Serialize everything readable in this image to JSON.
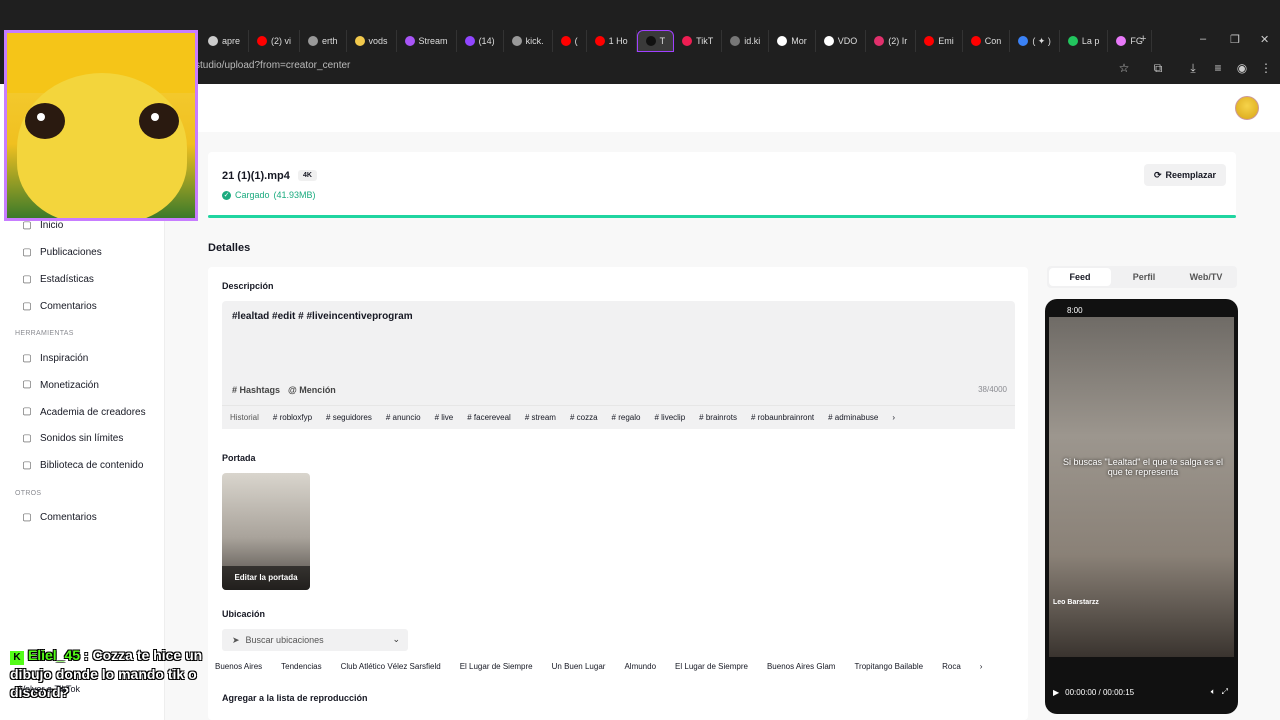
{
  "browser": {
    "tabs": [
      "apre",
      "(2) vi",
      "erth",
      "vods",
      "Stream",
      "(14)",
      "kick.",
      "(",
      "1 Ho",
      "T",
      "TikT",
      "id.ki",
      "Mor",
      "VDO",
      "(2) Ir",
      "Emi",
      "Con",
      "( ✦ )",
      "La p",
      "FG"
    ],
    "address": "studio/upload?from=creator_center"
  },
  "sidebar": {
    "items_top": [
      {
        "label": "Inicio",
        "icon": "home-icon"
      },
      {
        "label": "Publicaciones",
        "icon": "posts-icon"
      },
      {
        "label": "Estadísticas",
        "icon": "stats-icon"
      },
      {
        "label": "Comentarios",
        "icon": "comment-icon"
      }
    ],
    "section_tools": "HERRAMIENTAS",
    "items_tools": [
      {
        "label": "Inspiración",
        "icon": "bulb-icon"
      },
      {
        "label": "Monetización",
        "icon": "dollar-icon"
      },
      {
        "label": "Academia de creadores",
        "icon": "academy-icon"
      },
      {
        "label": "Sonidos sin límites",
        "icon": "music-icon"
      },
      {
        "label": "Biblioteca de contenido",
        "icon": "library-icon"
      }
    ],
    "section_others": "OTROS",
    "items_others": [
      {
        "label": "Comentarios",
        "icon": "feedback-icon"
      }
    ],
    "back": "Volver a TikTok"
  },
  "file": {
    "name": "21 (1)(1).mp4",
    "quality": "4K",
    "status": "Cargado",
    "size": "(41.93MB)",
    "replace": "Reemplazar",
    "progress": 1.0
  },
  "details": {
    "heading": "Detalles",
    "description_label": "Descripción",
    "description_text": "#lealtad  #edit  # #liveincentiveprogram",
    "hashtags": "# Hashtags",
    "mention": "@ Mención",
    "counter": "38/4000",
    "suggest_chips": [
      "Historial",
      "# robloxfyp",
      "# seguidores",
      "# anuncio",
      "# live",
      "# facereveal",
      "# stream",
      "# cozza",
      "# regalo",
      "# liveclip",
      "# brainrots",
      "# robaunbrainront",
      "# adminabuse"
    ],
    "cover_label": "Portada",
    "cover_edit": "Editar la portada",
    "location_label": "Ubicación",
    "location_placeholder": "Buscar ubicaciones",
    "location_chips": [
      "Buenos Aires",
      "Tendencias",
      "Club Atlético Vélez Sarsfield",
      "El Lugar de Siempre",
      "Un Buen Lugar",
      "Almundo",
      "El Lugar de Siempre",
      "Buenos Aires Glam",
      "Tropitango Bailable",
      "Roca"
    ],
    "playlist_label": "Agregar a la lista de reproducción"
  },
  "preview": {
    "tabs": [
      "Feed",
      "Perfil",
      "Web/TV"
    ],
    "time": "8:00",
    "caption": "Si buscas \"Lealtad\" el que te salga es el que te representa",
    "user": "Leo Barstarzz",
    "player_time": "00:00:00 / 00:00:15"
  },
  "chat": {
    "user": "Eliel_45",
    "message": "Cozza te hice un dibujo donde lo mando tik o discord?"
  }
}
